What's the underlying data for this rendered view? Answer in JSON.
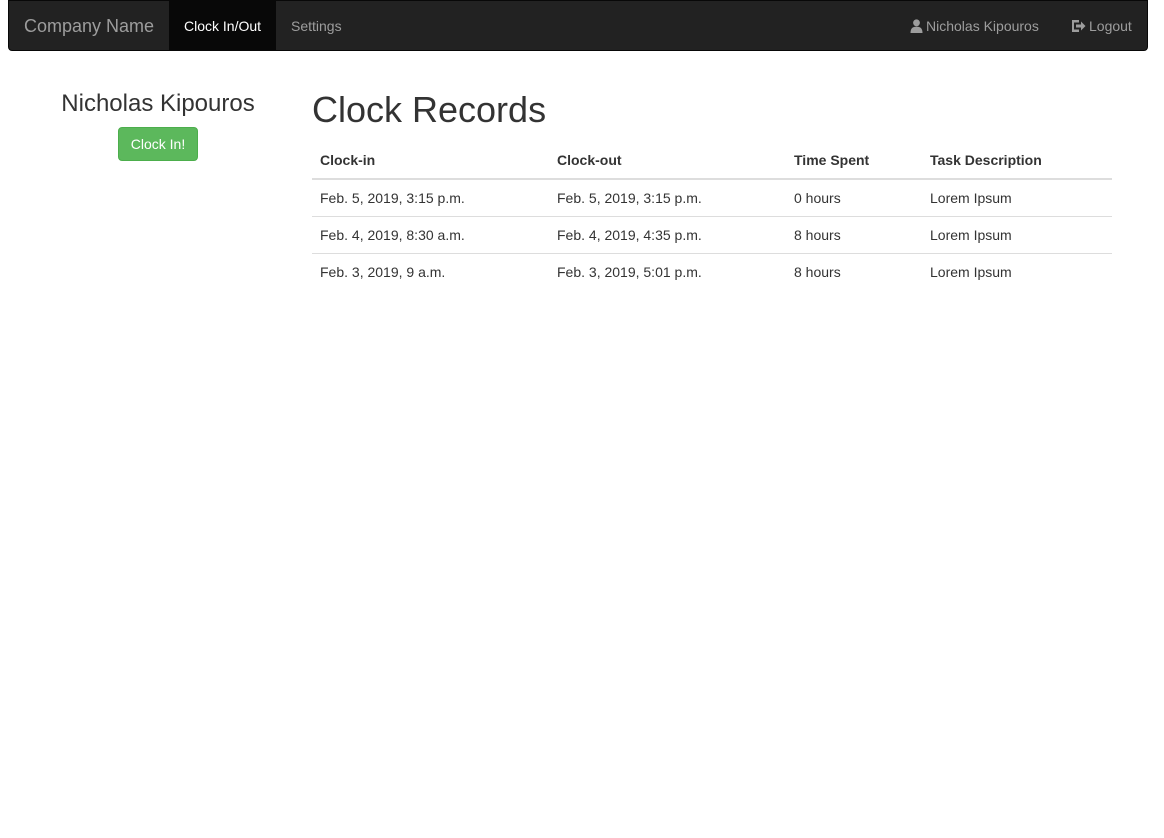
{
  "navbar": {
    "brand": "Company Name",
    "nav_items": [
      {
        "label": "Clock In/Out",
        "active": true
      },
      {
        "label": "Settings",
        "active": false
      }
    ],
    "user_label": "Nicholas Kipouros",
    "logout_label": "Logout",
    "colors": {
      "background": "#222222",
      "active": "#080808",
      "text": "#9d9d9d"
    }
  },
  "sidebar": {
    "user_name": "Nicholas Kipouros",
    "clock_button_label": "Clock In!",
    "button_color": "#5cb85c"
  },
  "main": {
    "title": "Clock Records",
    "columns": [
      "Clock-in",
      "Clock-out",
      "Time Spent",
      "Task Description"
    ],
    "rows": [
      [
        "Feb. 5, 2019, 3:15 p.m.",
        "Feb. 5, 2019, 3:15 p.m.",
        "0 hours",
        "Lorem Ipsum"
      ],
      [
        "Feb. 4, 2019, 8:30 a.m.",
        "Feb. 4, 2019, 4:35 p.m.",
        "8 hours",
        "Lorem Ipsum"
      ],
      [
        "Feb. 3, 2019, 9 a.m.",
        "Feb. 3, 2019, 5:01 p.m.",
        "8 hours",
        "Lorem Ipsum"
      ]
    ]
  }
}
